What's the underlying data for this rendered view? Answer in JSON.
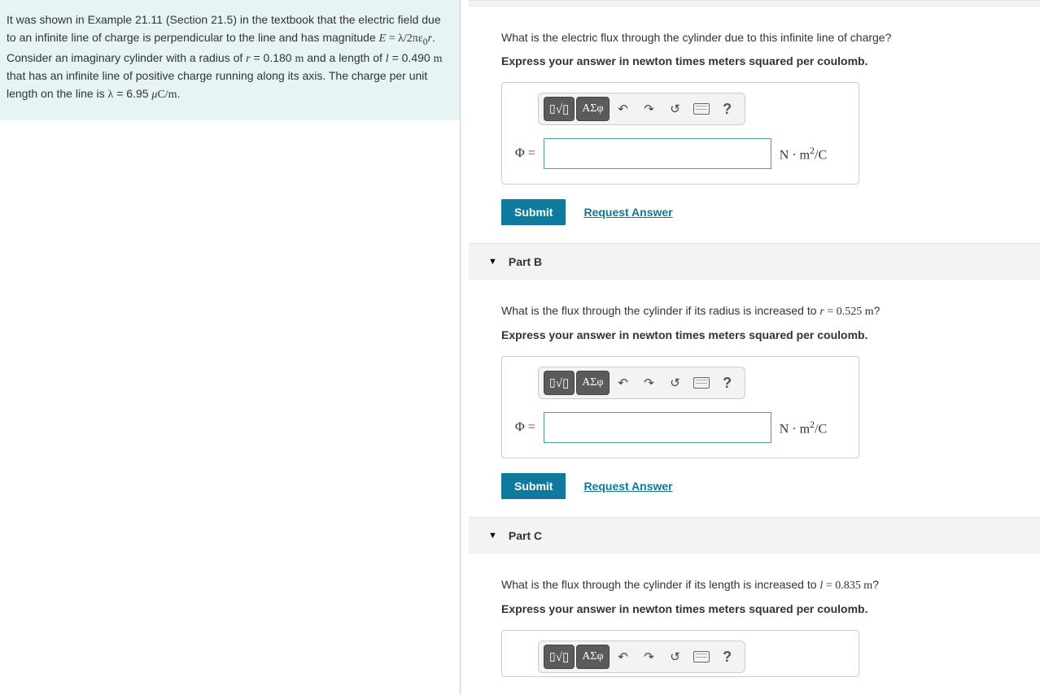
{
  "problem": {
    "text_html": "It was shown in Example 21.11 (Section 21.5) in the textbook that the electric field due to an infinite line of charge is perpendicular to the line and has magnitude <span class='math'><i>E</i> = λ/2π&epsilon;<sub>0</sub><i>r</i></span>. Consider an imaginary cylinder with a radius of <span class='math'><i>r</i></span> = 0.180 <span class='math'>m</span> and a length of <span class='math'><i>l</i></span> = 0.490 <span class='math'>m</span> that has an infinite line of positive charge running along its axis. The charge per unit length on the line is <span class='math'>λ</span> = 6.95 <span class='math'><i>μ</i>C/m</span>."
  },
  "partA": {
    "question": "What is the electric flux through the cylinder due to this infinite line of charge?",
    "instruction": "Express your answer in newton times meters squared per coulomb.",
    "var_label": "Φ = ",
    "unit_html": "N · m<sup>2</sup>/C",
    "submit": "Submit",
    "request": "Request Answer"
  },
  "partB": {
    "header": "Part B",
    "question_html": "What is the flux through the cylinder if its radius is increased to <span class='math'><i>r</i> = 0.525 m</span>?",
    "instruction": "Express your answer in newton times meters squared per coulomb.",
    "var_label": "Φ = ",
    "unit_html": "N · m<sup>2</sup>/C",
    "submit": "Submit",
    "request": "Request Answer"
  },
  "partC": {
    "header": "Part C",
    "question_html": "What is the flux through the cylinder if its length is increased to <span class='math'><i>l</i> = 0.835 m</span>?",
    "instruction": "Express your answer in newton times meters squared per coulomb."
  },
  "toolbar": {
    "templates": "▯√▯",
    "symbols": "ΑΣφ",
    "help": "?"
  }
}
